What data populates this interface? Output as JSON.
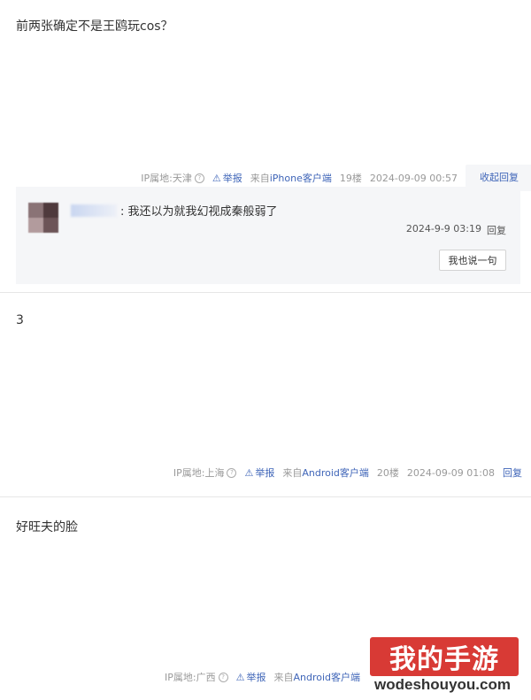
{
  "posts": [
    {
      "content": "前两张确定不是王鸥玩cos？",
      "ip": "IP属地:天津",
      "report": "举报",
      "client_prefix": "来自",
      "client_name": "iPhone客户端",
      "floor": "19楼",
      "time": "2024-09-09 00:57",
      "action": "收起回复"
    },
    {
      "content": "3",
      "ip": "IP属地:上海",
      "report": "举报",
      "client_prefix": "来自",
      "client_name": "Android客户端",
      "floor": "20楼",
      "time": "2024-09-09 01:08",
      "action": "回复"
    },
    {
      "content": "好旺夫的脸",
      "ip": "IP属地:广西",
      "report": "举报",
      "client_prefix": "来自",
      "client_name": "Android客户端"
    }
  ],
  "reply": {
    "text": ": 我还以为就我幻视成秦般弱了",
    "time": "2024-9-9 03:19",
    "reply_label": "回复",
    "say_button": "我也说一句"
  },
  "icons": {
    "help": "question-circle-icon",
    "report": "warning-triangle-icon"
  },
  "colors": {
    "link": "#3f65b8",
    "meta_text": "#999999",
    "reply_bg": "#f5f6f8",
    "watermark_red": "#d83a35"
  },
  "watermark": {
    "brand": "我的手游",
    "url": "wodeshouyou.com"
  }
}
